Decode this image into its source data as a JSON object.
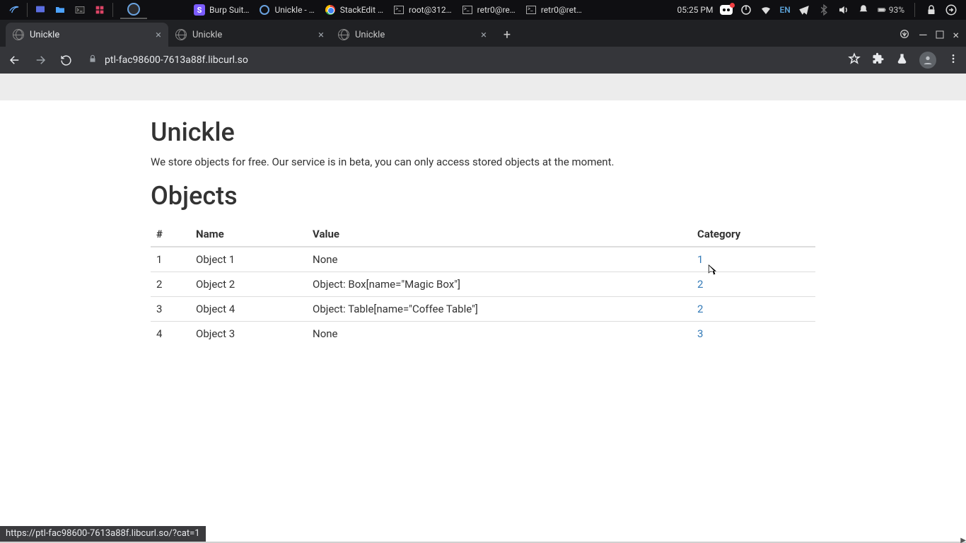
{
  "taskbar": {
    "apps": [
      {
        "iconClass": "burp",
        "iconText": "S",
        "label": "Burp Suit…"
      },
      {
        "iconClass": "chromium-mini",
        "iconText": "",
        "label": "Unickle - …"
      },
      {
        "iconClass": "chrome-ball",
        "iconText": "",
        "label": "StackEdit …"
      },
      {
        "iconClass": "term",
        "iconText": "",
        "label": "root@312…"
      },
      {
        "iconClass": "term",
        "iconText": "",
        "label": "retr0@re…"
      },
      {
        "iconClass": "term",
        "iconText": "",
        "label": "retr0@ret…"
      }
    ],
    "time": "05:25 PM",
    "lang": "EN",
    "battery": "93%"
  },
  "browser": {
    "tabs": [
      {
        "title": "Unickle",
        "active": true
      },
      {
        "title": "Unickle",
        "active": false
      },
      {
        "title": "Unickle",
        "active": false
      }
    ],
    "url": "ptl-fac98600-7613a88f.libcurl.so"
  },
  "page": {
    "title": "Unickle",
    "lead": "We store objects for free. Our service is in beta, you can only access stored objects at the moment.",
    "heading": "Objects",
    "columns": {
      "hash": "#",
      "name": "Name",
      "value": "Value",
      "category": "Category"
    },
    "rows": [
      {
        "idx": "1",
        "name": "Object 1",
        "value": "None",
        "category": "1"
      },
      {
        "idx": "2",
        "name": "Object 2",
        "value": "Object: Box[name=\"Magic Box\"]",
        "category": "2"
      },
      {
        "idx": "3",
        "name": "Object 4",
        "value": "Object: Table[name=\"Coffee Table\"]",
        "category": "2"
      },
      {
        "idx": "4",
        "name": "Object 3",
        "value": "None",
        "category": "3"
      }
    ]
  },
  "status": "https://ptl-fac98600-7613a88f.libcurl.so/?cat=1"
}
